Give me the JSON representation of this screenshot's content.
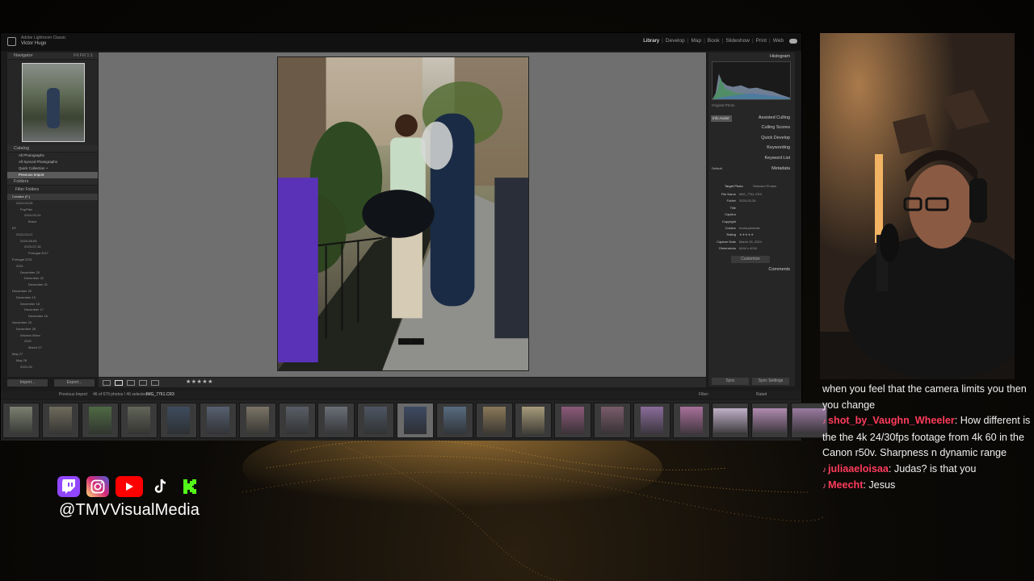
{
  "lightroom": {
    "app_name": "Adobe Lightroom Classic",
    "user_name": "Victor Hugo",
    "modules": [
      "Library",
      "Develop",
      "Map",
      "Book",
      "Slideshow",
      "Print",
      "Web"
    ],
    "active_module": "Library",
    "left_panel": {
      "navigator_label": "Navigator",
      "zoom_opts": "Fit  Fill  1:1",
      "catalog_label": "Catalog",
      "catalog_items": [
        "All Photographs",
        "All Synced Photographs",
        "Quick Collection +",
        "Previous Import"
      ],
      "folders_label": "Folders",
      "filter_label": "Filter Folders",
      "folder_items": [
        "Creative (F:)",
        "2024-03-26",
        "PopPlan",
        "2024-03-24",
        "Brave",
        "EF",
        "2024-03-21",
        "2023-08-05",
        "2023-07-18",
        "Portugal 2017",
        "Portugal 2021",
        "2021",
        "December 23",
        "December 22",
        "December 21",
        "December 20",
        "December 19",
        "December 18",
        "December 17",
        "December 16",
        "November 29",
        "November 28",
        "Arizona Video",
        "2022",
        "March 27",
        "May 27",
        "May 28",
        "2022-05"
      ],
      "import_label": "Import...",
      "export_label": "Export..."
    },
    "toolbar": {
      "stars": "★★★★★"
    },
    "right_panel": {
      "histogram_label": "Histogram",
      "original_photo": "Original Photo",
      "info_chip": "Info Assist",
      "sections": [
        "Assisted Culling",
        "Culling Scores",
        "Quick Develop",
        "Keywording",
        "Keyword List",
        "Metadata",
        "Comments"
      ],
      "preset_label": "Default",
      "tabs": [
        "Target Photo",
        "Selected Photos"
      ],
      "metadata_rows": [
        {
          "k": "File Name",
          "v": "IMG_7761.CR3"
        },
        {
          "k": "Folder",
          "v": "2024-03-26"
        },
        {
          "k": "Title",
          "v": ""
        },
        {
          "k": "Caption",
          "v": ""
        },
        {
          "k": "Copyright",
          "v": ""
        },
        {
          "k": "Creator",
          "v": "tmvisualmedia"
        },
        {
          "k": "Rating",
          "v": "★★★★★"
        },
        {
          "k": "Capture Date",
          "v": "March 26, 2024"
        },
        {
          "k": "Dimensions",
          "v": "6444 x 4016"
        }
      ],
      "customize_label": "Customize",
      "sync_label": "Sync",
      "sync_settings_label": "Sync Settings"
    },
    "filmstrip_bar": {
      "source": "Previous Import",
      "count": "46 of 679 photos / 46 selected",
      "filename": "IMG_7761.CR3",
      "filter_label": "Filter:",
      "filter_value": "Rated"
    },
    "thumb_labels": [
      "23",
      "23",
      "24"
    ]
  },
  "chat": [
    {
      "user": "",
      "text": "when you feel that the camera limits you then you change"
    },
    {
      "user": "shot_by_Vaughn_Wheeler",
      "text": ": How different is the the 4k 24/30fps footage from 4k 60 in the Canon r50v. Sharpness n dynamic range"
    },
    {
      "user": "juliaaeloisaa",
      "text": ": Judas? is that you"
    },
    {
      "user": "Meecht",
      "text": ": Jesus"
    }
  ],
  "social": {
    "handle": "@TMVVisualMedia",
    "icons": [
      "twitch-icon",
      "instagram-icon",
      "youtube-icon",
      "tiktok-icon",
      "kick-icon"
    ],
    "colors": {
      "twitch": "#9146ff",
      "youtube": "#ff0000",
      "kick": "#53fc18"
    }
  }
}
